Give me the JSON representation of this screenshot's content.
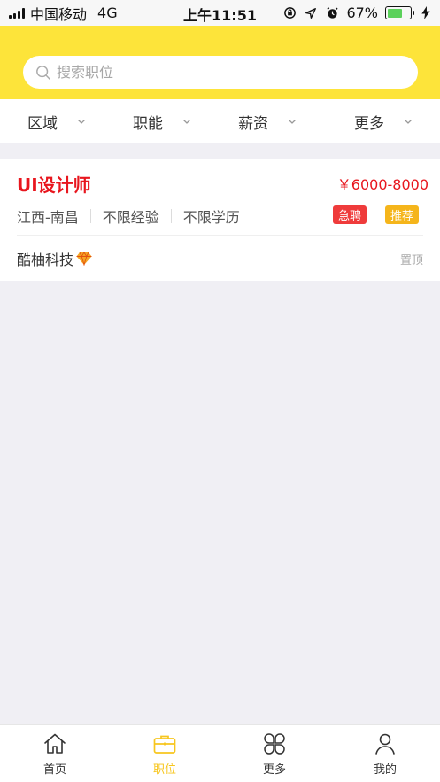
{
  "status_bar": {
    "carrier": "中国移动",
    "network": "4G",
    "time": "上午11:51",
    "battery": "67%",
    "battery_level": 0.67
  },
  "search": {
    "placeholder": "搜索职位"
  },
  "filters": [
    {
      "label": "区域"
    },
    {
      "label": "职能"
    },
    {
      "label": "薪资"
    },
    {
      "label": "更多"
    }
  ],
  "job": {
    "title": "UI设计师",
    "salary": "￥6000-8000",
    "location": "江西-南昌",
    "experience": "不限经验",
    "education": "不限学历",
    "tags": [
      "急聘",
      "推荐"
    ],
    "company": "酷柚科技",
    "action": "置顶"
  },
  "tabbar": [
    {
      "label": "首页",
      "active": false
    },
    {
      "label": "职位",
      "active": true
    },
    {
      "label": "更多",
      "active": false
    },
    {
      "label": "我的",
      "active": false
    }
  ],
  "colors": {
    "brand_yellow": "#fde43a",
    "accent_red": "#e8161e",
    "tab_active": "#f7c61e"
  }
}
